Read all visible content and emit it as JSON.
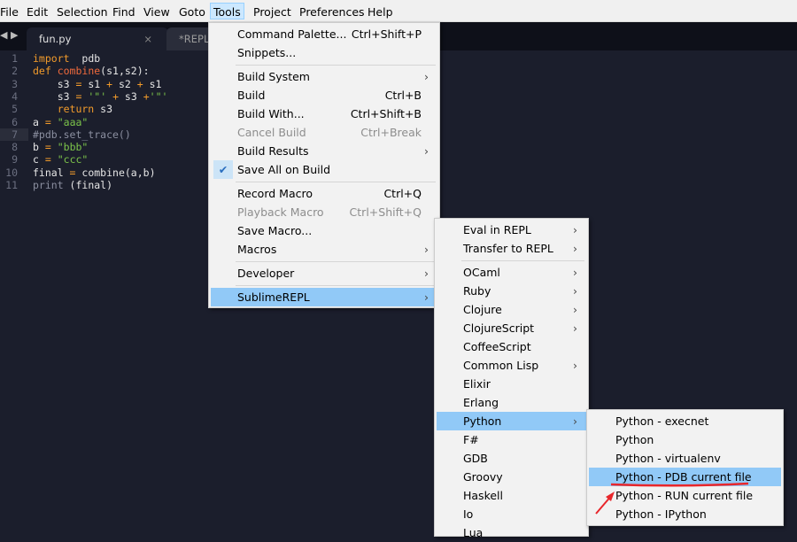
{
  "menubar": [
    "File",
    "Edit",
    "Selection",
    "Find",
    "View",
    "Goto",
    "Tools",
    "Project",
    "Preferences",
    "Help"
  ],
  "tabs": [
    {
      "label": "fun.py",
      "close": "×"
    },
    {
      "label": "*REPL*"
    }
  ],
  "code": [
    [
      [
        "k",
        "import"
      ],
      [
        "",
        "  pdb"
      ]
    ],
    [
      [
        "k",
        "def "
      ],
      [
        "f",
        "combine"
      ],
      [
        "",
        "(s1,s2):"
      ]
    ],
    [
      [
        "",
        "    s3 "
      ],
      [
        "o",
        "="
      ],
      [
        "",
        " s1 "
      ],
      [
        "o",
        "+"
      ],
      [
        "",
        " s2 "
      ],
      [
        "o",
        "+"
      ],
      [
        "",
        " s1"
      ]
    ],
    [
      [
        "",
        "    s3 "
      ],
      [
        "o",
        "="
      ],
      [
        "",
        " "
      ],
      [
        "s",
        "'\"'"
      ],
      [
        "",
        " "
      ],
      [
        "o",
        "+"
      ],
      [
        "",
        " s3 "
      ],
      [
        "o",
        "+"
      ],
      [
        "s",
        "'\"'"
      ]
    ],
    [
      [
        "k",
        "    return"
      ],
      [
        "",
        " s3"
      ]
    ],
    [
      [
        "",
        "a "
      ],
      [
        "o",
        "="
      ],
      [
        "",
        " "
      ],
      [
        "s",
        "\"aaa\""
      ]
    ],
    [
      [
        "c",
        "#pdb.set_trace()"
      ]
    ],
    [
      [
        "",
        "b "
      ],
      [
        "o",
        "="
      ],
      [
        "",
        " "
      ],
      [
        "s",
        "\"bbb\""
      ]
    ],
    [
      [
        "",
        "c "
      ],
      [
        "o",
        "="
      ],
      [
        "",
        " "
      ],
      [
        "s",
        "\"ccc\""
      ]
    ],
    [
      [
        "",
        "final "
      ],
      [
        "o",
        "="
      ],
      [
        "",
        " combine(a,b)"
      ]
    ],
    [
      [
        "c",
        "print"
      ],
      [
        "",
        " (final)"
      ]
    ]
  ],
  "tools_menu": [
    {
      "label": "Command Palette...",
      "shortcut": "Ctrl+Shift+P"
    },
    {
      "label": "Snippets..."
    },
    {
      "sep": true
    },
    {
      "label": "Build System",
      "submenu": true
    },
    {
      "label": "Build",
      "shortcut": "Ctrl+B"
    },
    {
      "label": "Build With...",
      "shortcut": "Ctrl+Shift+B"
    },
    {
      "label": "Cancel Build",
      "shortcut": "Ctrl+Break",
      "disabled": true
    },
    {
      "label": "Build Results",
      "submenu": true
    },
    {
      "label": "Save All on Build",
      "checked": true
    },
    {
      "sep": true
    },
    {
      "label": "Record Macro",
      "shortcut": "Ctrl+Q"
    },
    {
      "label": "Playback Macro",
      "shortcut": "Ctrl+Shift+Q",
      "disabled": true
    },
    {
      "label": "Save Macro..."
    },
    {
      "label": "Macros",
      "submenu": true
    },
    {
      "sep": true
    },
    {
      "label": "Developer",
      "submenu": true
    },
    {
      "sep": true
    },
    {
      "label": "SublimeREPL",
      "submenu": true,
      "selected": true
    }
  ],
  "repl_menu": [
    {
      "label": "Eval in REPL",
      "submenu": true
    },
    {
      "label": "Transfer to REPL",
      "submenu": true
    },
    {
      "sep": true
    },
    {
      "label": "OCaml",
      "submenu": true
    },
    {
      "label": "Ruby",
      "submenu": true
    },
    {
      "label": "Clojure",
      "submenu": true
    },
    {
      "label": "ClojureScript",
      "submenu": true
    },
    {
      "label": "CoffeeScript"
    },
    {
      "label": "Common Lisp",
      "submenu": true
    },
    {
      "label": "Elixir"
    },
    {
      "label": "Erlang"
    },
    {
      "label": "Python",
      "submenu": true,
      "selected": true
    },
    {
      "label": "F#"
    },
    {
      "label": "GDB"
    },
    {
      "label": "Groovy"
    },
    {
      "label": "Haskell"
    },
    {
      "label": "Io"
    },
    {
      "label": "Lua"
    }
  ],
  "python_menu": [
    {
      "label": "Python - execnet"
    },
    {
      "label": "Python"
    },
    {
      "label": "Python - virtualenv"
    },
    {
      "label": "Python - PDB current file",
      "selected": true
    },
    {
      "label": "Python - RUN current file"
    },
    {
      "label": "Python - IPython"
    }
  ],
  "icons": {
    "check": "checkmark-icon",
    "arrow": "chevron-right-icon",
    "annotation": "red-arrow-annotation"
  },
  "colors": {
    "highlight": "#91c9f7",
    "annotation": "#e8262b",
    "editor_bg": "#1b1e2c"
  }
}
